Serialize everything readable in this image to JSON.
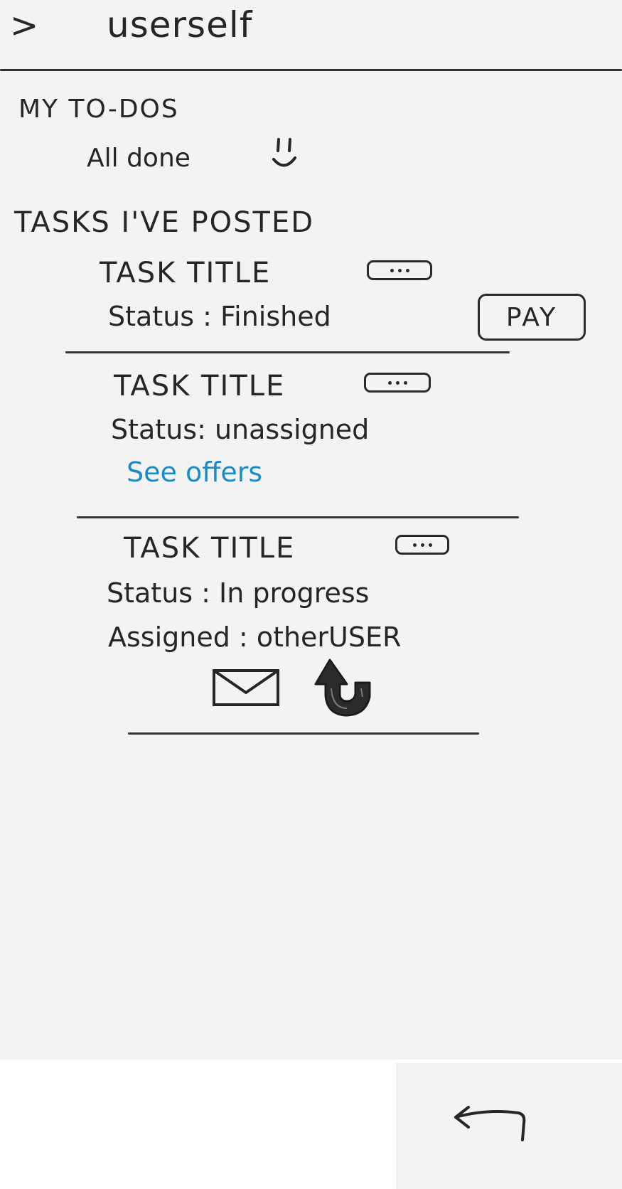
{
  "header": {
    "back_glyph": ">",
    "app_name": "userself"
  },
  "todos": {
    "heading": "My To-Dos",
    "empty_message": "All done"
  },
  "posted": {
    "heading": "Tasks I've Posted",
    "tasks": [
      {
        "title": "Task Title",
        "status_line": "Status : Finished",
        "action_label": "PAY"
      },
      {
        "title": "Task Title",
        "status_line": "Status: unassigned",
        "link_label": "See offers"
      },
      {
        "title": "Task Title",
        "status_line": "Status : In progress",
        "assigned_line": "Assigned : otherUSER"
      }
    ]
  },
  "colors": {
    "ink": "#262626",
    "link": "#1e8bc3",
    "paper": "#f3f3f3"
  },
  "icons": [
    "chevron-right-icon",
    "smiley-icon",
    "more-options-icon",
    "mail-icon",
    "share-icon",
    "back-arrow-icon"
  ]
}
